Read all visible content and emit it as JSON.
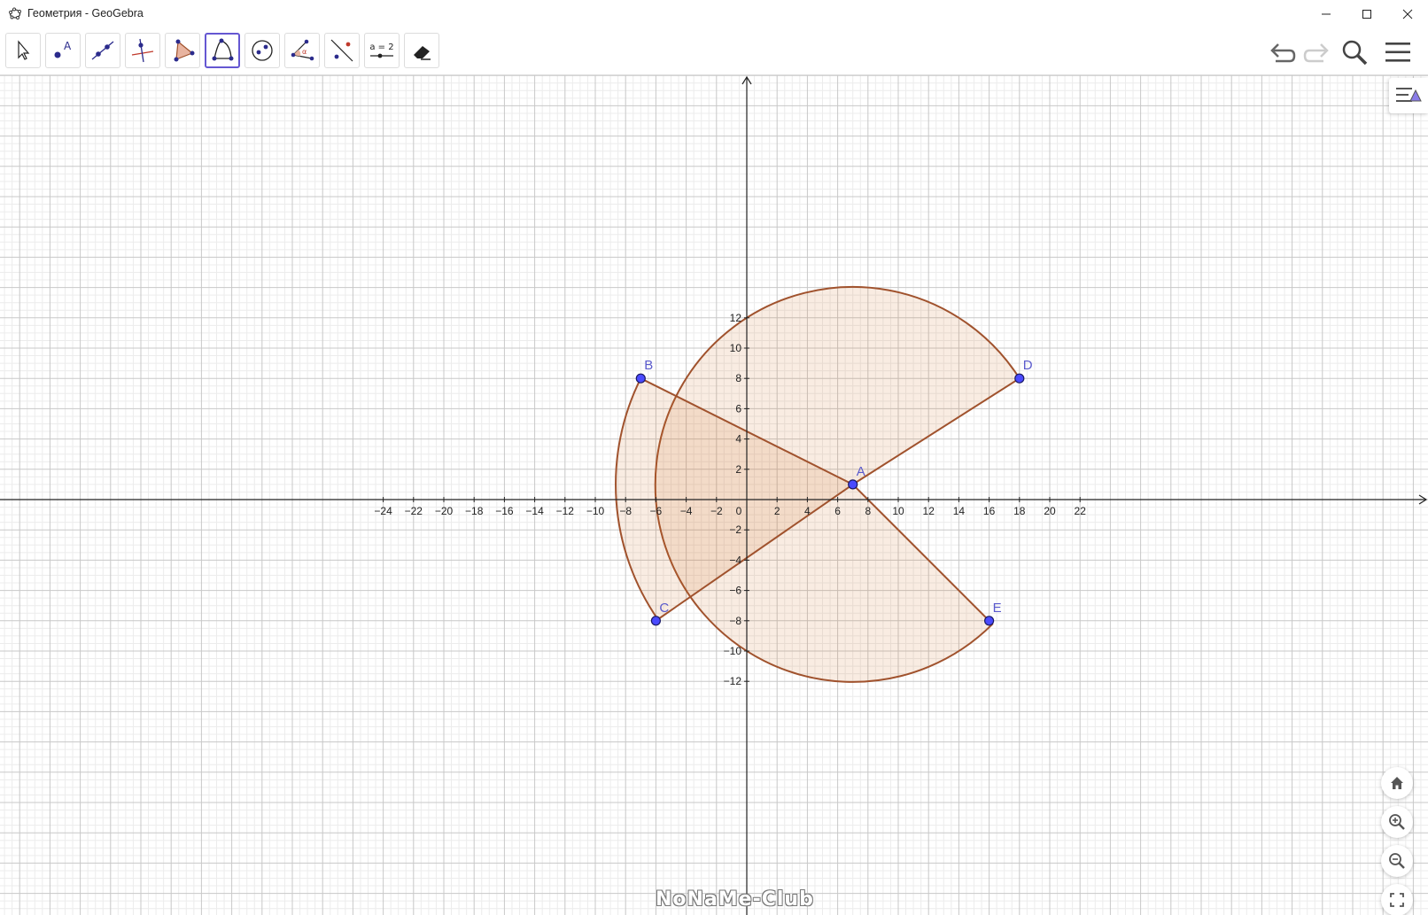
{
  "window": {
    "title": "Геометрия - GeoGebra"
  },
  "toolbar": {
    "tools": [
      {
        "name": "move-tool",
        "label": ""
      },
      {
        "name": "point-tool",
        "label": ""
      },
      {
        "name": "line-tool",
        "label": ""
      },
      {
        "name": "perpendicular-tool",
        "label": ""
      },
      {
        "name": "polygon-tool",
        "label": ""
      },
      {
        "name": "circle-sector-tool",
        "label": "",
        "active": true
      },
      {
        "name": "circle-tool",
        "label": ""
      },
      {
        "name": "angle-tool",
        "label": ""
      },
      {
        "name": "reflect-tool",
        "label": ""
      },
      {
        "name": "slider-tool",
        "label": "a = 2"
      },
      {
        "name": "eraser-tool",
        "label": ""
      }
    ],
    "slider_label": "a = 2"
  },
  "graph": {
    "x_ticks": [
      "−24",
      "−22",
      "−20",
      "−18",
      "−16",
      "−14",
      "−12",
      "−10",
      "−8",
      "−6",
      "−4",
      "−2",
      "0",
      "2",
      "4",
      "6",
      "8",
      "10",
      "12",
      "14",
      "16",
      "18",
      "20",
      "22"
    ],
    "y_ticks": [
      "12",
      "10",
      "8",
      "6",
      "4",
      "2",
      "−2",
      "−4",
      "−6",
      "−8",
      "−10",
      "−12"
    ],
    "points": [
      {
        "label": "A",
        "x": 7,
        "y": 1
      },
      {
        "label": "B",
        "x": -7,
        "y": 8
      },
      {
        "label": "C",
        "x": -6,
        "y": -8
      },
      {
        "label": "D",
        "x": 18,
        "y": 8
      },
      {
        "label": "E",
        "x": 16,
        "y": -8
      }
    ],
    "colors": {
      "sector_stroke": "#a0522d",
      "sector_fill": "#d2691e",
      "point": "#4a4aff",
      "label": "#5a5acc"
    }
  },
  "watermark": "NoNaMe-Club"
}
